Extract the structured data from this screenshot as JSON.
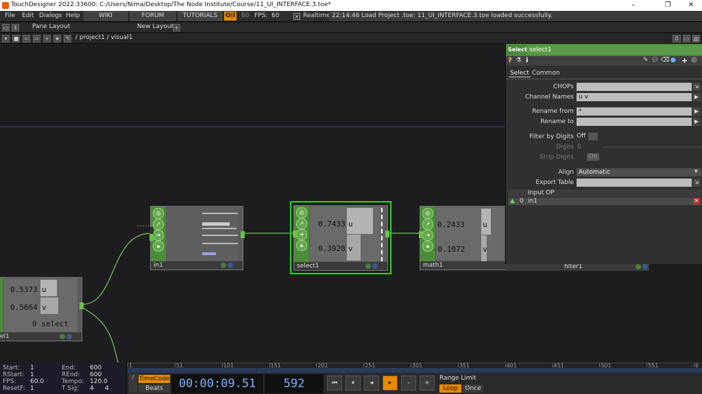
{
  "window": {
    "title": "TouchDesigner 2022.33600: C:/Users/Nima/Desktop/The Node Institute/Course/11_UI_INTERFACE.3.toe*"
  },
  "menu": {
    "items": [
      "File",
      "Edit",
      "Dialogs",
      "Help"
    ],
    "wiki": "WIKI",
    "forum": "FORUM",
    "tutorials": "TUTORIALS",
    "oi": "O|I",
    "fps_small": "60",
    "fps_label": "FPS:",
    "fps_value": "60",
    "realtime_label": "Realtime",
    "realtime_check": "✕",
    "status": "22:14:46 Load Project .toe: 11_UI_INTERFACE.3.toe loaded successfully."
  },
  "panebar": {
    "pane_layout": "Pane Layout",
    "new_layout": "New Layout",
    "plus": "+"
  },
  "pathbar": {
    "path": "/ project1 / visual1",
    "right_btn": "0"
  },
  "nodes": {
    "in1": {
      "name": "in1"
    },
    "select1": {
      "name": "select1",
      "val_u": "0.7433",
      "ch_u": "u",
      "val_v": "0.3928",
      "ch_v": "v"
    },
    "math1": {
      "name": "math1",
      "val_u": "0.2433",
      "ch_u": "u",
      "val_v": "-0.1072",
      "ch_v": "v"
    },
    "filter1": {
      "name": "filter1"
    },
    "panel1": {
      "name": "el1",
      "val_u": "0.5373",
      "ch_u": "u",
      "val_v": "0.5664",
      "ch_v": "v",
      "select": "0 select"
    }
  },
  "params": {
    "op_type": "Select",
    "op_name": "select1",
    "tabs": [
      "Select",
      "Common"
    ],
    "chops_label": "CHOPs",
    "chops_value": "",
    "channel_names_label": "Channel Names",
    "channel_names_value": "u  v",
    "rename_from_label": "Rename from",
    "rename_from_value": "*",
    "rename_to_label": "Rename to",
    "rename_to_value": "",
    "filter_digits_label": "Filter by Digits",
    "filter_digits_value": "Off",
    "digits_label": "Digits",
    "digits_value": "0",
    "strip_digits_label": "Strip Digits",
    "strip_digits_value": "On",
    "align_label": "Align",
    "align_value": "Automatic",
    "export_table_label": "Export Table",
    "export_table_value": "",
    "input_op_header": "Input OP",
    "input_row_index": "0",
    "input_row_value": "in1"
  },
  "timeline": {
    "ticks": [
      "1",
      "51",
      "101",
      "151",
      "201",
      "251",
      "301",
      "351",
      "401",
      "451",
      "501",
      "551",
      "6"
    ]
  },
  "bottom": {
    "start_label": "Start:",
    "start_value": "1",
    "end_label": "End:",
    "end_value": "600",
    "rstart_label": "RStart:",
    "rstart_value": "1",
    "rend_label": "REnd:",
    "rend_value": "600",
    "fps_label": "FPS:",
    "fps_value": "60.0",
    "tempo_label": "Tempo:",
    "tempo_value": "120.0",
    "resetf_label": "ResetF:",
    "resetf_value": "1",
    "tsig_label": "T Sig:",
    "tsig_a": "4",
    "tsig_b": "4",
    "timecode_label": "TimeCode",
    "beats_label": "Beats",
    "timecode": "00:00:09.51",
    "frame": "592",
    "range_limit": "Range Limit",
    "loop": "Loop",
    "once": "Once"
  },
  "colors": {
    "accent_orange": "#e88a00",
    "node_green": "#4d8c3a",
    "selected_outline": "#22dd22",
    "timecode_blue": "#7fb2ff"
  }
}
